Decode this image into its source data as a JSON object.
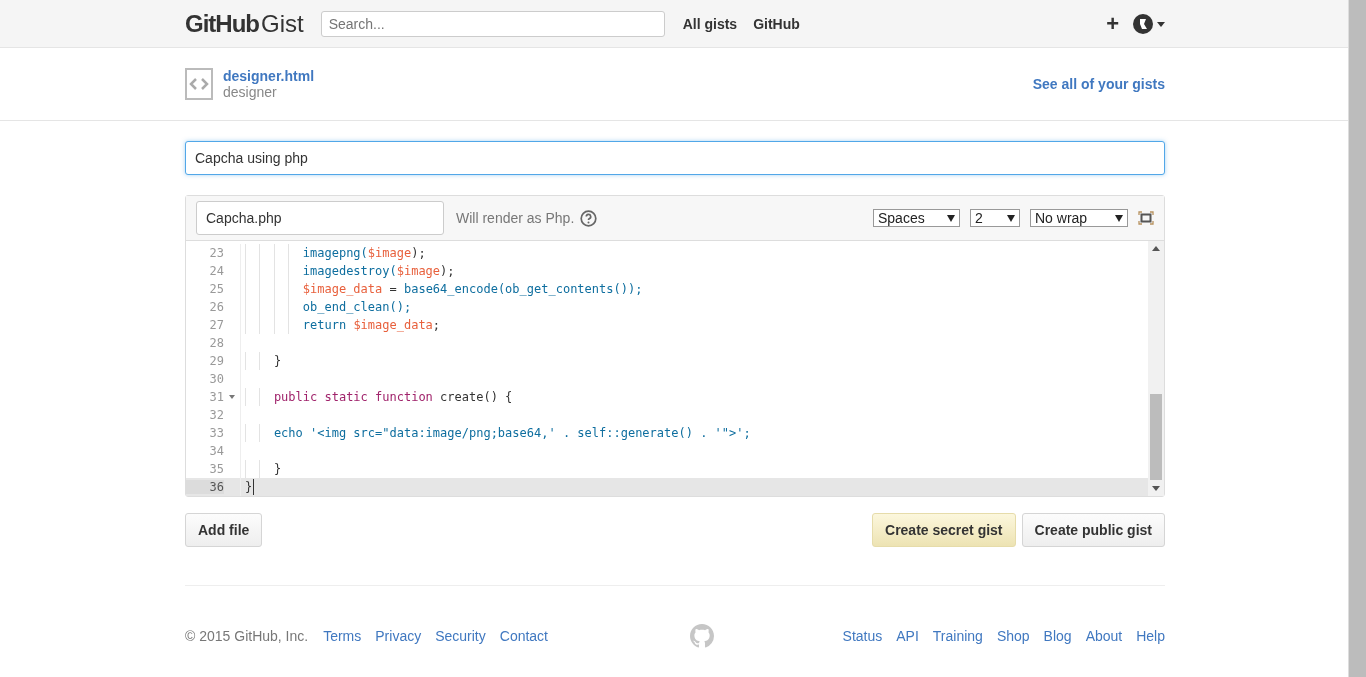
{
  "header": {
    "logo_bold": "GitHub",
    "logo_light": "Gist",
    "search": {
      "placeholder": "Search..."
    },
    "nav": [
      "All gists",
      "GitHub"
    ],
    "plus": "+"
  },
  "gist": {
    "filename": "designer.html",
    "owner": "designer",
    "see_all": "See all of your gists"
  },
  "description": {
    "value": "Capcha using php"
  },
  "editor": {
    "filename": "Capcha.php",
    "render_note": "Will render as Php.",
    "selects": [
      {
        "value": "Spaces"
      },
      {
        "value": "2"
      },
      {
        "value": "No wrap"
      }
    ],
    "lines": [
      {
        "n": "23",
        "fold": false,
        "active": false,
        "tokens": [
          {
            "kind": "fn",
            "t": "        imagepng("
          },
          {
            "kind": "var",
            "t": "$image"
          },
          {
            "kind": "plain",
            "t": ");"
          }
        ]
      },
      {
        "n": "24",
        "fold": false,
        "active": false,
        "tokens": [
          {
            "kind": "fn",
            "t": "        imagedestroy("
          },
          {
            "kind": "var",
            "t": "$image"
          },
          {
            "kind": "plain",
            "t": ");"
          }
        ]
      },
      {
        "n": "25",
        "fold": false,
        "active": false,
        "tokens": [
          {
            "kind": "var",
            "t": "        $image_data"
          },
          {
            "kind": "plain",
            "t": " = "
          },
          {
            "kind": "fn",
            "t": "base64_encode(ob_get_contents());"
          }
        ]
      },
      {
        "n": "26",
        "fold": false,
        "active": false,
        "tokens": [
          {
            "kind": "fn",
            "t": "        ob_end_clean();"
          }
        ]
      },
      {
        "n": "27",
        "fold": false,
        "active": false,
        "tokens": [
          {
            "kind": "fn",
            "t": "        return "
          },
          {
            "kind": "var",
            "t": "$image_data"
          },
          {
            "kind": "plain",
            "t": ";"
          }
        ]
      },
      {
        "n": "28",
        "fold": false,
        "active": false
      },
      {
        "n": "29",
        "fold": false,
        "active": false,
        "tokens": [
          {
            "kind": "plain",
            "t": "    }"
          }
        ]
      },
      {
        "n": "30",
        "fold": false,
        "active": false
      },
      {
        "n": "31",
        "fold": true,
        "active": false,
        "tokens": [
          {
            "kind": "kw",
            "t": "    public static function "
          },
          {
            "kind": "plain",
            "t": "create() {"
          }
        ]
      },
      {
        "n": "32",
        "fold": false,
        "active": false
      },
      {
        "n": "33",
        "fold": false,
        "active": false,
        "tokens": [
          {
            "kind": "fn",
            "t": "    echo '<img src=\"data:image/png;base64,' . self::generate() . '\">';"
          }
        ]
      },
      {
        "n": "34",
        "fold": false,
        "active": false
      },
      {
        "n": "35",
        "fold": false,
        "active": false,
        "tokens": [
          {
            "kind": "plain",
            "t": "    }"
          }
        ]
      },
      {
        "n": "36",
        "fold": false,
        "active": true,
        "tokens": [
          {
            "kind": "plain",
            "t": "}"
          }
        ]
      }
    ]
  },
  "actions": {
    "add_file": "Add file",
    "secret": "Create secret gist",
    "public": "Create public gist"
  },
  "footer": {
    "copyright": "© 2015 GitHub, Inc.",
    "left_links": [
      "Terms",
      "Privacy",
      "Security",
      "Contact"
    ],
    "right_links": [
      "Status",
      "API",
      "Training",
      "Shop",
      "Blog",
      "About",
      "Help"
    ]
  }
}
